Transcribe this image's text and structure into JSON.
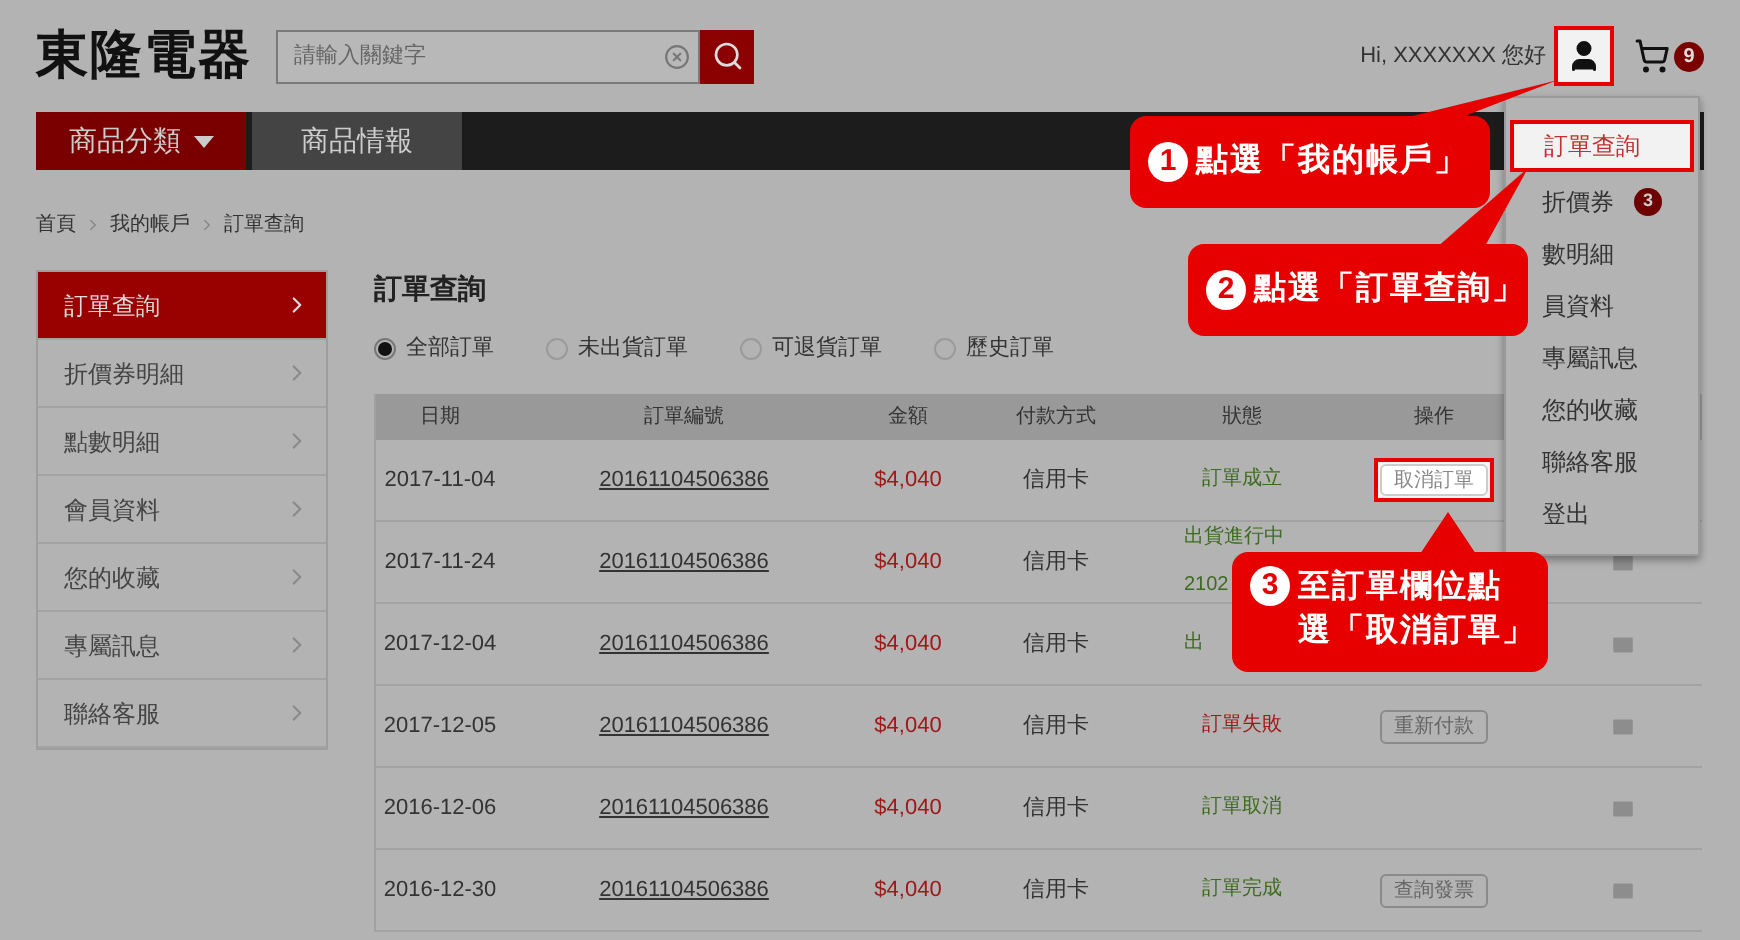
{
  "header": {
    "logo": "東隆電器",
    "search": {
      "placeholder": "請輸入關鍵字"
    },
    "greeting": "Hi, XXXXXXX 您好",
    "account_highlighted": true,
    "cart_count": "9"
  },
  "nav": [
    {
      "label": "商品分類",
      "selected": true,
      "kind": "dropdown"
    },
    {
      "label": "商品情報",
      "selected": false,
      "kind": "plain"
    }
  ],
  "breadcrumb": [
    "首頁",
    "我的帳戶",
    "訂單查詢"
  ],
  "sidebar": [
    {
      "label": "訂單查詢",
      "selected": true
    },
    {
      "label": "折價券明細",
      "selected": false
    },
    {
      "label": "點數明細",
      "selected": false
    },
    {
      "label": "會員資料",
      "selected": false
    },
    {
      "label": "您的收藏",
      "selected": false
    },
    {
      "label": "專屬訊息",
      "selected": false
    },
    {
      "label": "聯絡客服",
      "selected": false
    }
  ],
  "title": "訂單查詢",
  "filters": [
    {
      "label": "全部訂單",
      "selected": true
    },
    {
      "label": "未出貨訂單",
      "selected": false
    },
    {
      "label": "可退貨訂單",
      "selected": false
    },
    {
      "label": "歷史訂單",
      "selected": false
    }
  ],
  "table": {
    "columns": [
      "日期",
      "訂單編號",
      "金額",
      "付款方式",
      "狀態",
      "操作"
    ],
    "rows": [
      {
        "date": "2017-11-04",
        "order_no": "20161104506386",
        "amount": "$4,040",
        "payment": "信用卡",
        "status": {
          "kind": "full",
          "lines": [
            "訂單成立"
          ],
          "color": "#3d6b1f"
        },
        "action": {
          "label": "取消訂單",
          "highlighted": true
        },
        "message_icon": false
      },
      {
        "date": "2017-11-24",
        "order_no": "20161104506386",
        "amount": "$4,040",
        "payment": "信用卡",
        "status": {
          "kind": "cut",
          "lines": [
            "出貨進行中",
            "2102"
          ],
          "color": "#3d6b1f"
        },
        "message_icon": true
      },
      {
        "date": "2017-12-04",
        "order_no": "20161104506386",
        "amount": "$4,040",
        "payment": "信用卡",
        "status": {
          "kind": "cut",
          "lines": [
            "出"
          ],
          "color": "#3d6b1f"
        },
        "message_icon": true
      },
      {
        "date": "2017-12-05",
        "order_no": "20161104506386",
        "amount": "$4,040",
        "payment": "信用卡",
        "status": {
          "kind": "full",
          "lines": [
            "訂單失敗"
          ],
          "color": "#a01818"
        },
        "action": {
          "label": "重新付款",
          "highlighted": false
        },
        "message_icon": true
      },
      {
        "date": "2016-12-06",
        "order_no": "20161104506386",
        "amount": "$4,040",
        "payment": "信用卡",
        "status": {
          "kind": "full",
          "lines": [
            "訂單取消"
          ],
          "color": "#3d6b1f"
        },
        "message_icon": true
      },
      {
        "date": "2016-12-30",
        "order_no": "20161104506386",
        "amount": "$4,040",
        "payment": "信用卡",
        "status": {
          "kind": "full",
          "lines": [
            "訂單完成"
          ],
          "color": "#3d6b1f"
        },
        "action": {
          "label": "查詢發票",
          "highlighted": false
        },
        "message_icon": true
      }
    ]
  },
  "account_menu": [
    {
      "label": "訂單查詢",
      "highlighted": true
    },
    {
      "label": "折價券",
      "highlighted": false,
      "badge": "3"
    },
    {
      "label": "數明細",
      "highlighted": false
    },
    {
      "label": "員資料",
      "highlighted": false
    },
    {
      "label": "專屬訊息",
      "highlighted": false
    },
    {
      "label": "您的收藏",
      "highlighted": false
    },
    {
      "label": "聯絡客服",
      "highlighted": false
    },
    {
      "label": "登出",
      "highlighted": false
    }
  ],
  "callouts": [
    {
      "number": "1",
      "lines": [
        "點選「我的帳戶」"
      ]
    },
    {
      "number": "2",
      "lines": [
        "點選「訂單查詢」"
      ]
    },
    {
      "number": "3",
      "lines": [
        "至訂單欄位點",
        "選「取消訂單」"
      ]
    }
  ]
}
